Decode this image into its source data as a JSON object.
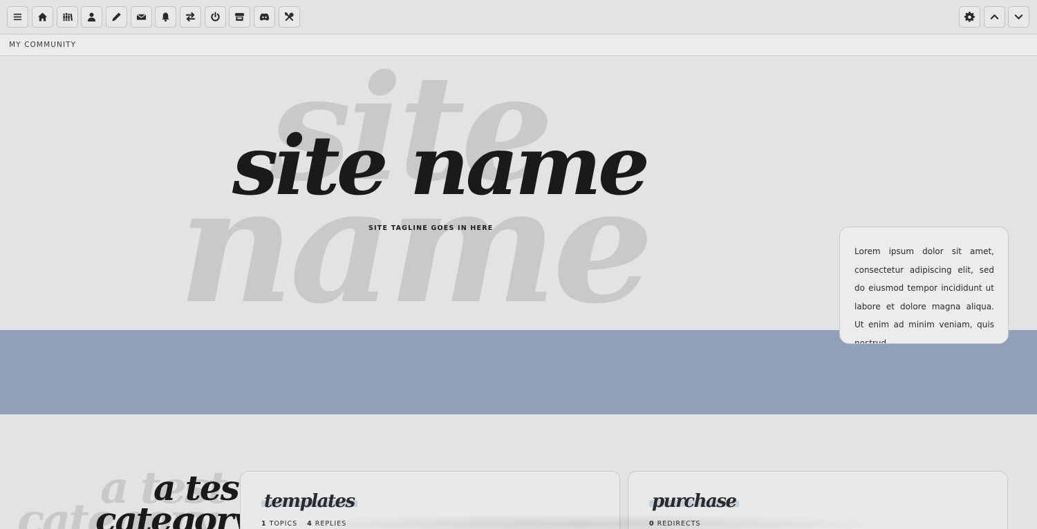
{
  "toolbar": {
    "left_buttons": [
      {
        "icon": "menu-icon"
      },
      {
        "icon": "home-icon"
      },
      {
        "icon": "library-icon"
      },
      {
        "icon": "user-icon"
      },
      {
        "icon": "pencil-icon"
      },
      {
        "icon": "envelope-icon"
      },
      {
        "icon": "bell-icon"
      },
      {
        "icon": "swap-icon"
      },
      {
        "icon": "power-icon"
      },
      {
        "icon": "store-icon"
      },
      {
        "icon": "discord-icon"
      },
      {
        "icon": "tools-icon"
      }
    ],
    "right_buttons": [
      {
        "icon": "gear-icon"
      },
      {
        "icon": "chevron-up-icon"
      },
      {
        "icon": "chevron-down-icon"
      }
    ]
  },
  "breadcrumb": {
    "label": "MY COMMUNITY"
  },
  "hero": {
    "ghost_line1": "site",
    "ghost_line2": "name",
    "title": "site name",
    "tagline": "SITE TAGLINE GOES IN HERE"
  },
  "lorem_card": {
    "text": "Lorem ipsum dolor sit amet, consectetur adipiscing elit, sed do eiusmod tempor incididunt ut labore et dolore magna aliqua. Ut enim ad minim veniam, quis nostrud"
  },
  "category": {
    "ghost_line1": "a test",
    "ghost_line2": "category",
    "title_line1": "a test",
    "title_line2": "category",
    "forums": [
      {
        "name": "templates",
        "stats": [
          {
            "count": "1",
            "label": "TOPICS"
          },
          {
            "count": "4",
            "label": "REPLIES"
          }
        ]
      },
      {
        "name": "purchase",
        "stats": [
          {
            "count": "0",
            "label": "REDIRECTS"
          }
        ]
      }
    ]
  },
  "colors": {
    "background": "#e3e3e3",
    "band": "#8fa1ba",
    "ghost_text": "#c9c9c9",
    "title_text": "#1a1a1a",
    "highlight": "#c7cfdb"
  }
}
